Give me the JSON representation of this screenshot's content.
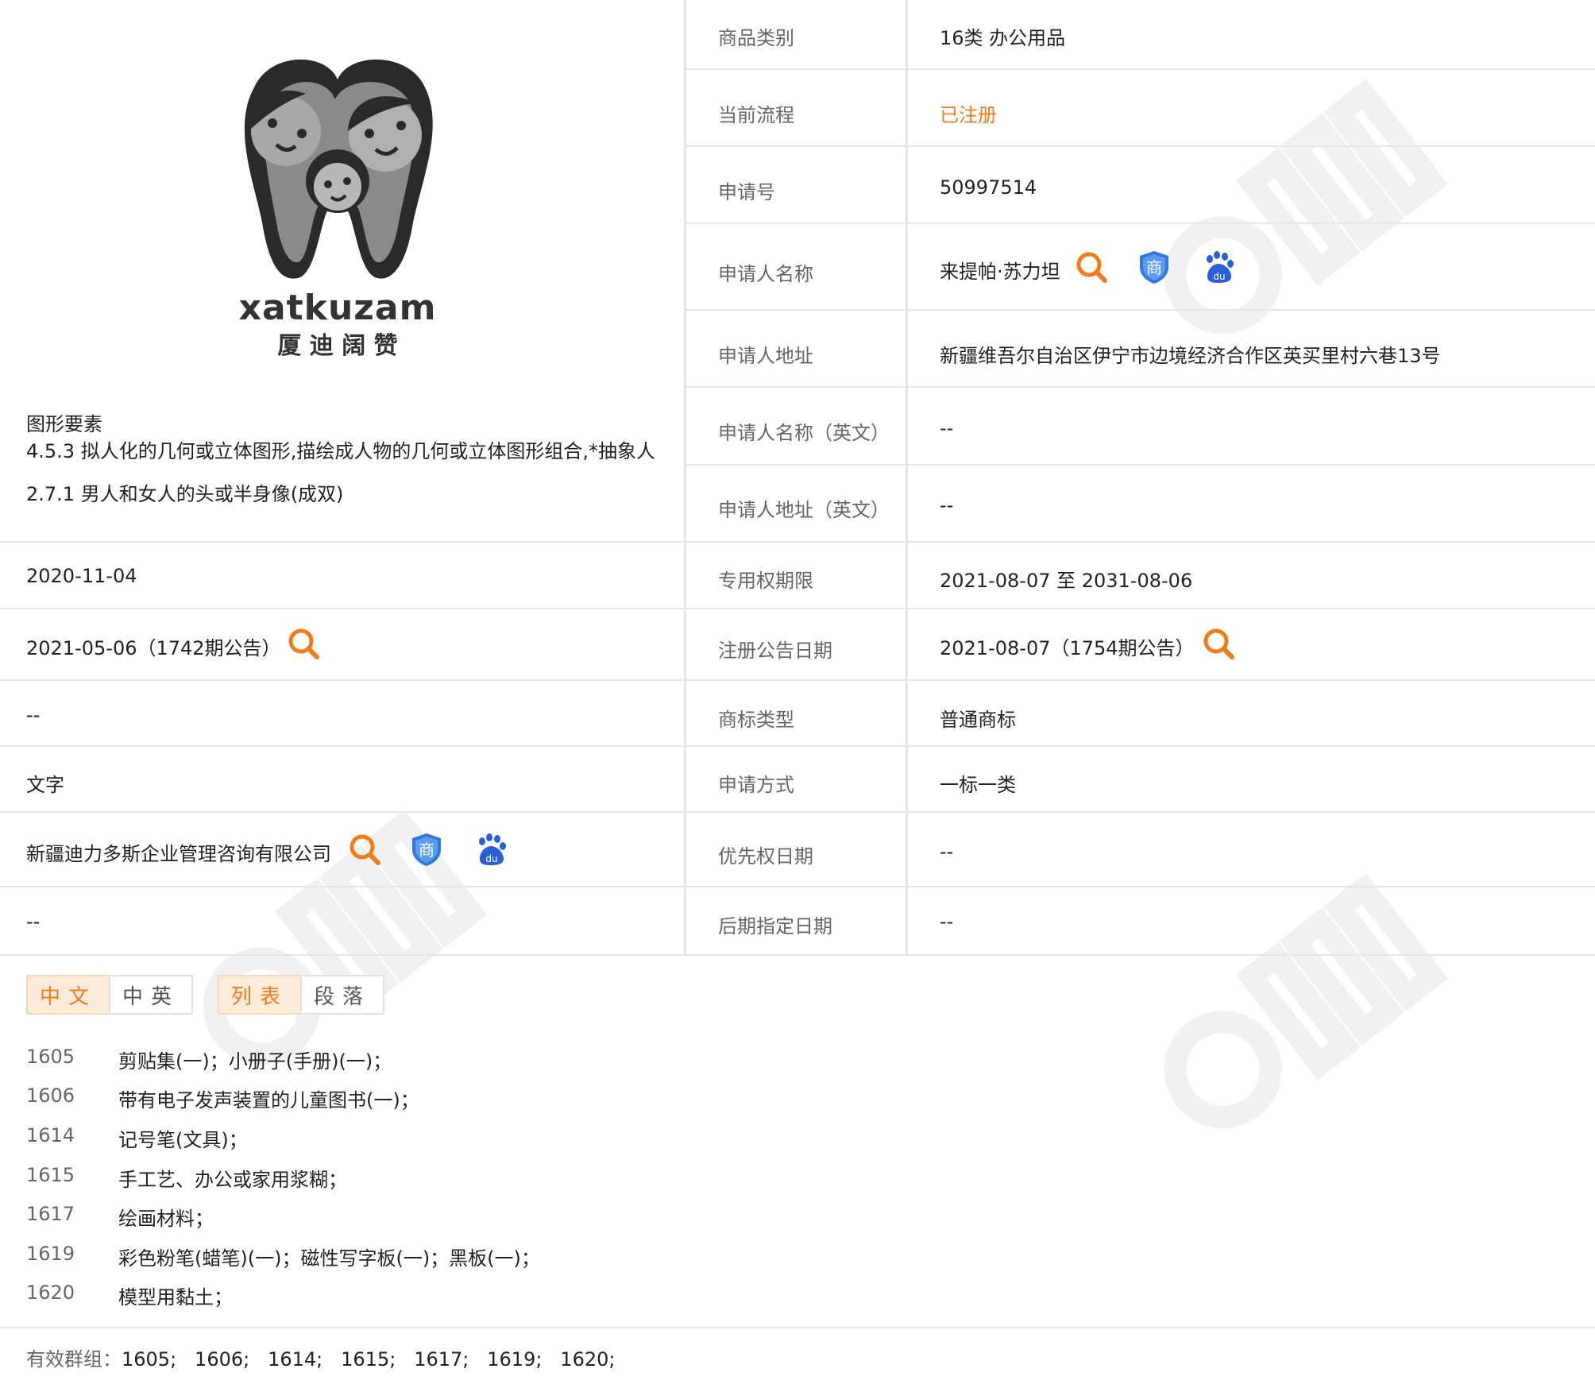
{
  "logo": {
    "wordmark": "xatkuzam",
    "chinese": "厦 迪 阔 赞"
  },
  "figure_elements": {
    "title": "图形要素",
    "line1": "4.5.3 拟人化的几何或立体图形,描绘成人物的几何或立体图形组合,*抽象人",
    "line2": "2.7.1 男人和女人的头或半身像(成双)"
  },
  "left_rows": {
    "application_date": "2020-11-04",
    "preliminary_date": "2021-05-06（1742期公告）",
    "row3": "--",
    "row4": "文字",
    "agent": "新疆迪力多斯企业管理咨询有限公司",
    "row6": "--"
  },
  "right_rows": [
    {
      "label": "商品类别",
      "value": "16类 办公用品"
    },
    {
      "label": "当前流程",
      "value": "已注册"
    },
    {
      "label": "申请号",
      "value": "50997514"
    },
    {
      "label": "申请人名称",
      "value": "来提帕·苏力坦"
    },
    {
      "label": "申请人地址",
      "value": "新疆维吾尔自治区伊宁市边境经济合作区英买里村六巷13号"
    },
    {
      "label": "申请人名称（英文）",
      "value": "--"
    },
    {
      "label": "申请人地址（英文）",
      "value": "--"
    },
    {
      "label": "专用权期限",
      "value": "2021-08-07 至 2031-08-06"
    },
    {
      "label": "注册公告日期",
      "value": "2021-08-07（1754期公告）"
    },
    {
      "label": "商标类型",
      "value": "普通商标"
    },
    {
      "label": "申请方式",
      "value": "一标一类"
    },
    {
      "label": "优先权日期",
      "value": "--"
    },
    {
      "label": "后期指定日期",
      "value": "--"
    }
  ],
  "tabs": {
    "lang_cn": "中文",
    "lang_cn_en": "中英",
    "view_list": "列表",
    "view_paragraph": "段落"
  },
  "goods": [
    {
      "code": "1605",
      "text": "剪贴集(一)；小册子(手册)(一)；"
    },
    {
      "code": "1606",
      "text": "带有电子发声装置的儿童图书(一)；"
    },
    {
      "code": "1614",
      "text": "记号笔(文具)；"
    },
    {
      "code": "1615",
      "text": "手工艺、办公或家用浆糊；"
    },
    {
      "code": "1617",
      "text": "绘画材料；"
    },
    {
      "code": "1619",
      "text": "彩色粉笔(蜡笔)(一)；磁性写字板(一)；黑板(一)；"
    },
    {
      "code": "1620",
      "text": "模型用黏土；"
    }
  ],
  "groups": {
    "label": "有效群组：",
    "values": "1605;   1606;   1614;   1615;   1617;   1619;   1620;"
  },
  "icons": {
    "search": "search-icon",
    "trademark": "trademark-shield-icon",
    "baidu": "baidu-paw-icon"
  },
  "colors": {
    "accent": "#f07c1a",
    "shield": "#2f7ae0",
    "baidu": "#2b5fd9",
    "divider": "#e6e6e6"
  }
}
